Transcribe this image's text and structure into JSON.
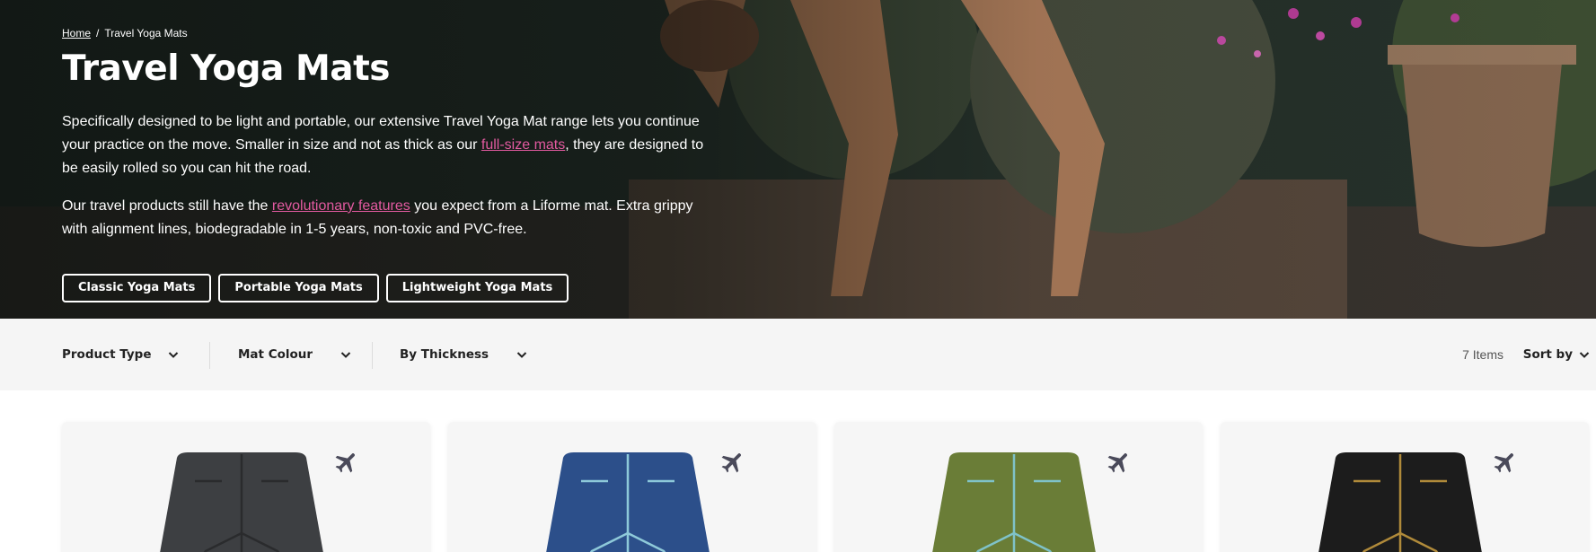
{
  "breadcrumb": {
    "home": "Home",
    "separator": "/",
    "current": "Travel Yoga Mats"
  },
  "page_title": "Travel Yoga Mats",
  "intro": {
    "p1_a": "Specifically designed to be light and portable, our extensive Travel Yoga Mat range lets you continue your practice on the move. Smaller in size and not as thick as our ",
    "p1_link": "full-size mats",
    "p1_b": ", they are designed to be easily rolled so you can hit the road.",
    "p2_a": "Our travel products still have the ",
    "p2_link": "revolutionary features",
    "p2_b": " you expect from a Liforme mat. Extra grippy with alignment lines, biodegradable in 1-5 years, non-toxic and PVC-free."
  },
  "hero_buttons": [
    "Classic Yoga Mats",
    "Portable Yoga Mats",
    "Lightweight Yoga Mats"
  ],
  "filters": {
    "product_type": "Product Type",
    "mat_colour": "Mat Colour",
    "by_thickness": "By Thickness"
  },
  "items_count": "7 Items",
  "sort_label": "Sort by",
  "products": [
    {
      "icon": "airplane-icon",
      "mat_color": "#3d3f42",
      "line_color": "#2a2b2d"
    },
    {
      "icon": "airplane-icon",
      "mat_color": "#2c4f8a",
      "line_color": "#8ec9d9"
    },
    {
      "icon": "airplane-icon",
      "mat_color": "#6a7d37",
      "line_color": "#7fc2c9"
    },
    {
      "icon": "airplane-icon",
      "mat_color": "#1c1c1c",
      "line_color": "#b08a3a"
    }
  ],
  "colors": {
    "link": "#e25aa0",
    "filter_bg": "#f5f5f5",
    "icon_dark": "#4a4a5a"
  }
}
